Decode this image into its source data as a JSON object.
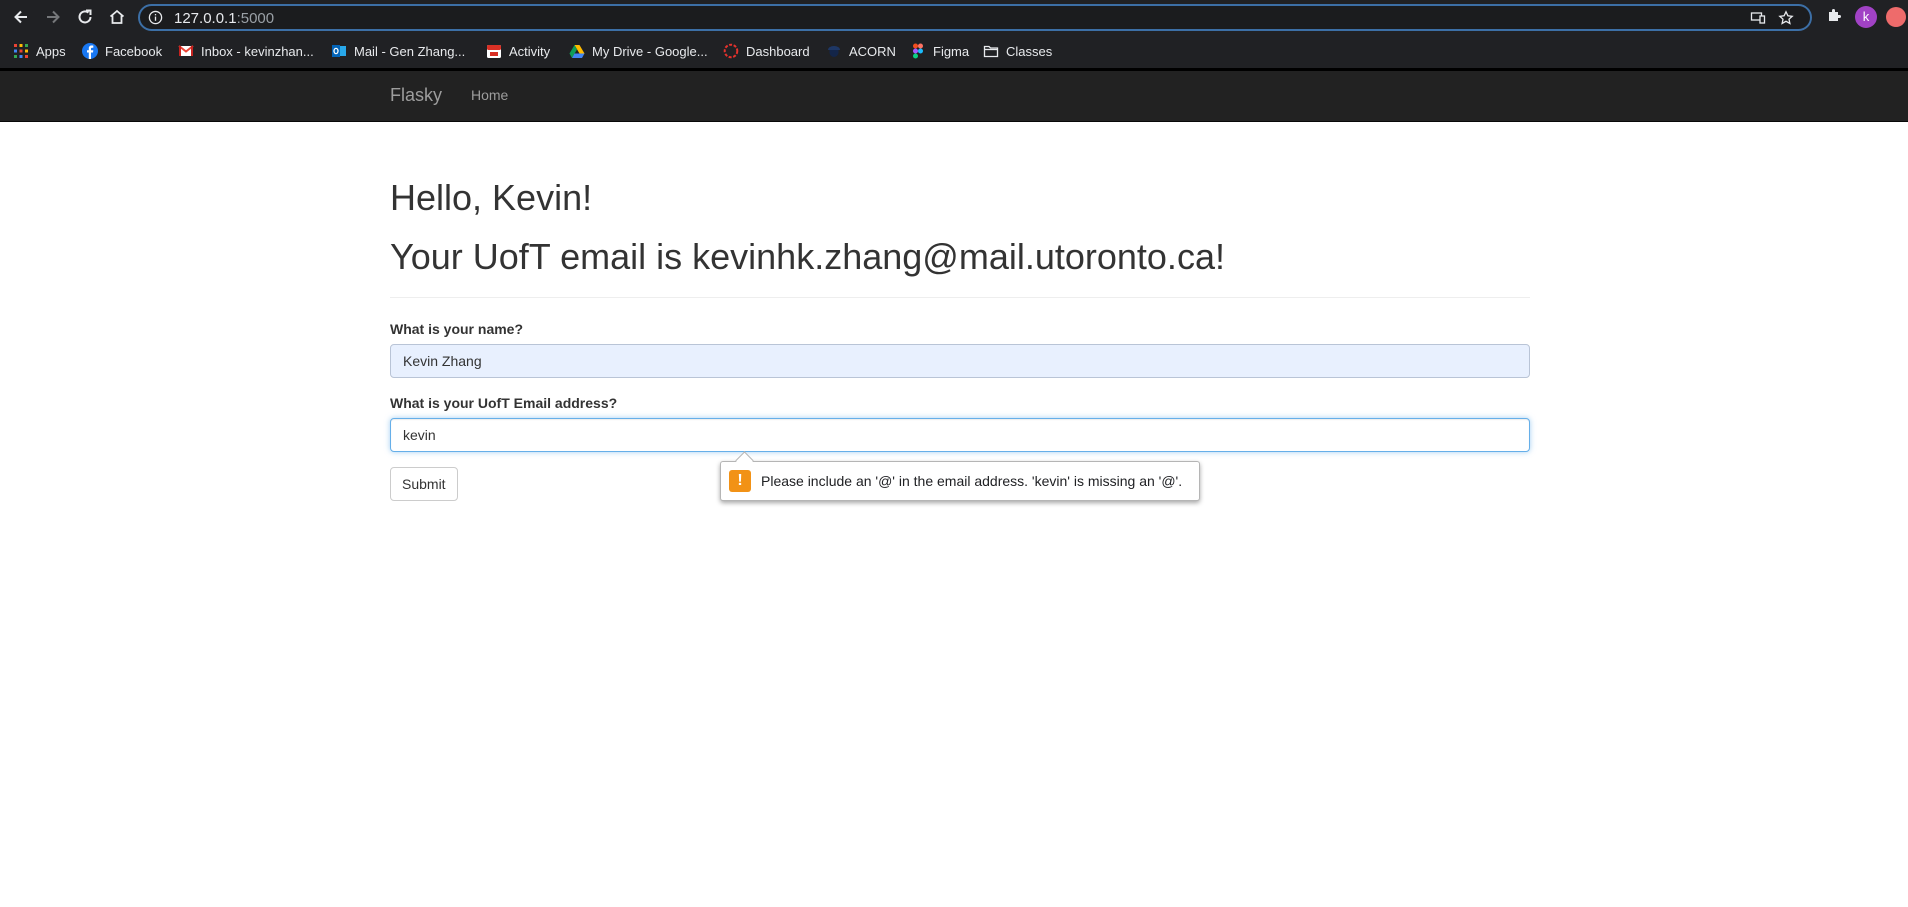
{
  "browser": {
    "url_host": "127.0.0.1",
    "url_port": ":5000",
    "profile_initial": "k",
    "bookmarks": [
      {
        "label": "Apps",
        "icon": "apps-grid-icon"
      },
      {
        "label": "Facebook",
        "icon": "facebook-icon"
      },
      {
        "label": "Inbox - kevinzhan...",
        "icon": "gmail-icon"
      },
      {
        "label": "Mail - Gen Zhang...",
        "icon": "outlook-icon"
      },
      {
        "label": "Activity",
        "icon": "calendar-icon"
      },
      {
        "label": "My Drive - Google...",
        "icon": "google-drive-icon"
      },
      {
        "label": "Dashboard",
        "icon": "dashboard-icon"
      },
      {
        "label": "ACORN",
        "icon": "acorn-icon"
      },
      {
        "label": "Figma",
        "icon": "figma-icon"
      },
      {
        "label": "Classes",
        "icon": "folder-icon"
      }
    ]
  },
  "navbar": {
    "brand": "Flasky",
    "links": [
      "Home"
    ]
  },
  "main": {
    "greeting": "Hello, Kevin!",
    "email_line": "Your UofT email is kevinhk.zhang@mail.utoronto.ca!",
    "form": {
      "name_label": "What is your name?",
      "name_value": "Kevin Zhang",
      "email_label": "What is your UofT Email address?",
      "email_value": "kevin",
      "submit_label": "Submit"
    },
    "validation_message": "Please include an '@' in the email address. 'kevin' is missing an '@'."
  },
  "colors": {
    "navbar_bg": "#222222",
    "focus_border": "#66afe9",
    "autofill_bg": "#e8f0fe",
    "warning_icon": "#f29216"
  }
}
